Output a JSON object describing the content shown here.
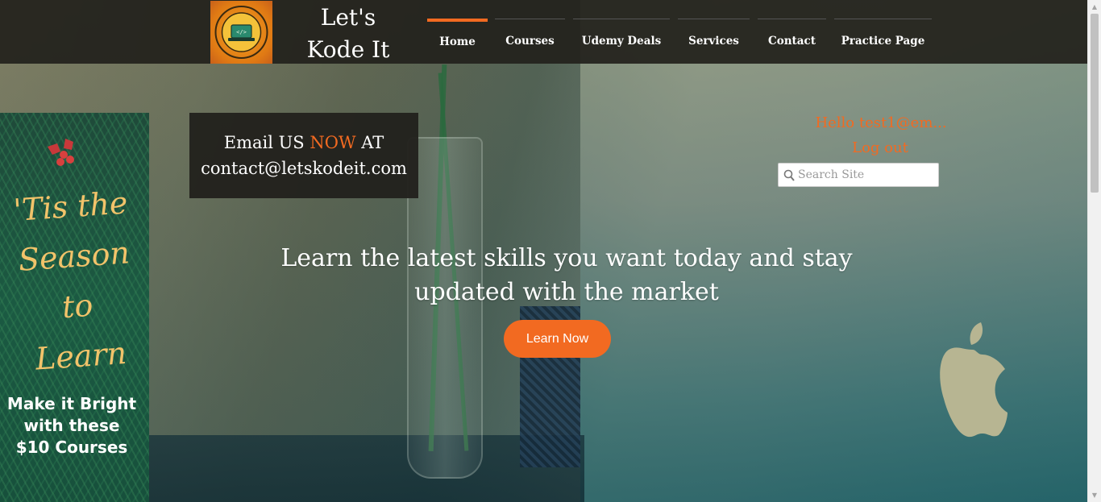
{
  "brand": {
    "line1": "Let's",
    "line2": "Kode It",
    "logo_text_top": "LET'S KODE IT",
    "logo_text_bottom": "Anyone Can Code"
  },
  "nav": {
    "items": [
      {
        "label": "Home",
        "active": true
      },
      {
        "label": "Courses"
      },
      {
        "label": "Udemy Deals"
      },
      {
        "label": "Services"
      },
      {
        "label": "Contact"
      },
      {
        "label": "Practice Page"
      }
    ],
    "accent_color": "#f26a21"
  },
  "promo": {
    "script_line1": "'Tis the",
    "script_line2": "Season",
    "script_line3": "to Learn",
    "sub_line1": "Make it Bright",
    "sub_line2": "with these",
    "sub_line3": "$10 Courses"
  },
  "email": {
    "prefix": "Email US ",
    "highlight": "NOW",
    "suffix": " AT",
    "address": "contact@letskodeit.com"
  },
  "user": {
    "greeting": "Hello test1@em...",
    "logout_label": "Log out"
  },
  "search": {
    "placeholder": "Search Site",
    "icon": "search-icon"
  },
  "hero": {
    "line1": "Learn the latest skills you want today and stay",
    "line2": "updated with the market",
    "cta_label": "Learn Now"
  }
}
